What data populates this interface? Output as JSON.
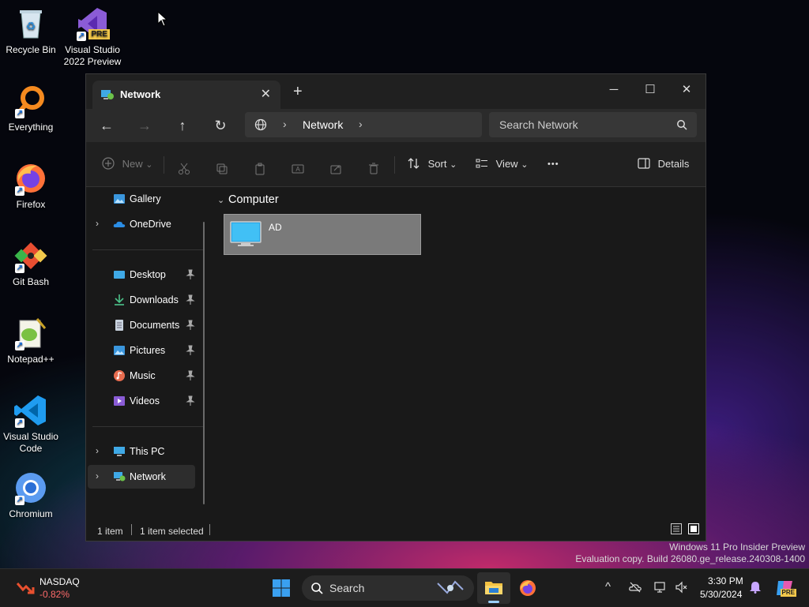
{
  "desktop": {
    "icons": [
      {
        "label": "Recycle Bin",
        "icon": "recycle-bin-icon"
      },
      {
        "label": "Visual Studio 2022 Preview",
        "icon": "visual-studio-icon",
        "badge": "PRE"
      },
      {
        "label": "Everything",
        "icon": "everything-search-icon"
      },
      {
        "label": "Firefox",
        "icon": "firefox-icon"
      },
      {
        "label": "Git Bash",
        "icon": "git-bash-icon"
      },
      {
        "label": "Notepad++",
        "icon": "notepad-plus-plus-icon"
      },
      {
        "label": "Visual Studio Code",
        "icon": "vscode-icon"
      },
      {
        "label": "Chromium",
        "icon": "chromium-icon"
      }
    ],
    "shortcut_glyph": "↗"
  },
  "explorer": {
    "tab_title": "Network",
    "new_tab_glyph": "+",
    "close_tab_glyph": "✕",
    "window_controls": {
      "minimize": "─",
      "maximize": "☐",
      "close": "✕"
    },
    "nav": {
      "back": "←",
      "forward": "→",
      "up": "↑",
      "refresh": "↻"
    },
    "address": {
      "chevron": "›",
      "crumb": "Network"
    },
    "search": {
      "placeholder": "Search Network"
    },
    "toolbar": {
      "new_label": "New",
      "sort_label": "Sort",
      "view_label": "View",
      "more_glyph": "•••",
      "details_label": "Details",
      "dropdown_glyph": "⌄"
    },
    "sidebar": {
      "items": [
        {
          "label": "Gallery",
          "icon": "gallery-icon"
        },
        {
          "label": "OneDrive",
          "icon": "onedrive-icon",
          "expand": "›"
        },
        {
          "label": "Desktop",
          "icon": "desktop-folder-icon",
          "pinned": true
        },
        {
          "label": "Downloads",
          "icon": "downloads-icon",
          "pinned": true
        },
        {
          "label": "Documents",
          "icon": "documents-icon",
          "pinned": true
        },
        {
          "label": "Pictures",
          "icon": "pictures-icon",
          "pinned": true
        },
        {
          "label": "Music",
          "icon": "music-icon",
          "pinned": true
        },
        {
          "label": "Videos",
          "icon": "videos-icon",
          "pinned": true
        },
        {
          "label": "This PC",
          "icon": "this-pc-icon",
          "expand": "›"
        },
        {
          "label": "Network",
          "icon": "network-icon",
          "expand": "›",
          "selected": true
        }
      ]
    },
    "content": {
      "group_header": "Computer",
      "group_chevron": "⌄",
      "items": [
        {
          "name": "AD",
          "icon": "computer-monitor-icon",
          "selected": true
        }
      ]
    },
    "status": {
      "count": "1 item",
      "selection": "1 item selected"
    }
  },
  "watermark": {
    "line1": "Windows 11 Pro Insider Preview",
    "line2": "Evaluation copy. Build 26080.ge_release.240308-1400"
  },
  "taskbar": {
    "stock_name": "NASDAQ",
    "stock_change": "-0.82%",
    "search_placeholder": "Search",
    "tray_chevron": "^",
    "time": "3:30 PM",
    "date": "5/30/2024",
    "copilot_badge": "PRE"
  },
  "colors": {
    "accent": "#0078d4",
    "selected_item": "#7a7a7a",
    "stock_down": "#ff6b6b"
  }
}
